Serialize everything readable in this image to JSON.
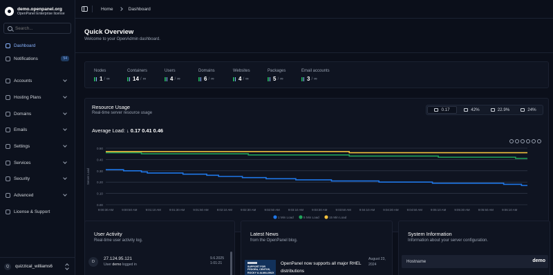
{
  "brand": {
    "title": "demo.openpanel.org",
    "subtitle": "OpenPanel Enterprise license"
  },
  "search": {
    "placeholder": "Search..."
  },
  "sidebar": {
    "items": [
      {
        "label": "Dashboard"
      },
      {
        "label": "Notifications",
        "badge": "54"
      },
      {
        "label": "Accounts"
      },
      {
        "label": "Hosting Plans"
      },
      {
        "label": "Domains"
      },
      {
        "label": "Emails"
      },
      {
        "label": "Settings"
      },
      {
        "label": "Services"
      },
      {
        "label": "Security"
      },
      {
        "label": "Advanced"
      },
      {
        "label": "License & Support"
      }
    ],
    "user": {
      "initial": "Q",
      "name": "quizzical_williams6"
    }
  },
  "breadcrumb": {
    "home": "Home",
    "current": "Dashboard"
  },
  "page": {
    "title": "Quick Overview",
    "subtitle": "Welcome to your OpenAdmin dashboard."
  },
  "stats": [
    {
      "label": "Nodes",
      "value": "1",
      "limit": "∞"
    },
    {
      "label": "Containers",
      "value": "14",
      "limit": "∞"
    },
    {
      "label": "Users",
      "value": "4",
      "limit": "∞"
    },
    {
      "label": "Domains",
      "value": "6",
      "limit": "∞"
    },
    {
      "label": "Websites",
      "value": "4",
      "limit": "∞"
    },
    {
      "label": "Packages",
      "value": "5",
      "limit": "∞"
    },
    {
      "label": "Email accounts",
      "value": "3",
      "limit": "∞"
    }
  ],
  "resource": {
    "title": "Resource Usage",
    "subtitle": "Real-time server resource usage",
    "tabs": [
      "0.17",
      "42%",
      "22.9%",
      "24%"
    ],
    "avg_label": "Average Load:",
    "avg_values": "0.17 0.41 0.46"
  },
  "colors": {
    "accent": "#8ab4ff",
    "load1": "#1f77e8",
    "load5": "#21a35a",
    "load15": "#f4c13d",
    "bg": "#0b0f1a"
  },
  "chart_data": {
    "type": "line",
    "x": [
      "9:00:30 AM",
      "9:00:35 AM",
      "9:00:40 AM",
      "9:00:45 AM",
      "9:00:50 AM",
      "9:00:55 AM",
      "9:01:00 AM",
      "9:01:05 AM",
      "9:01:10 AM",
      "9:01:15 AM",
      "9:01:20 AM",
      "9:01:25 AM",
      "9:01:30 AM",
      "9:01:35 AM",
      "9:01:40 AM",
      "9:01:45 AM",
      "9:01:50 AM",
      "9:01:55 AM",
      "9:02:00 AM",
      "9:02:05 AM",
      "9:02:10 AM",
      "9:02:15 AM",
      "9:02:20 AM",
      "9:02:25 AM",
      "9:02:30 AM",
      "9:02:35 AM",
      "9:02:40 AM",
      "9:02:45 AM",
      "9:02:50 AM",
      "9:02:55 AM",
      "9:03:00 AM",
      "9:03:05 AM",
      "9:03:10 AM",
      "9:03:15 AM",
      "9:03:20 AM",
      "9:03:25 AM",
      "9:03:30 AM",
      "9:03:35 AM",
      "9:03:40 AM",
      "9:03:45 AM",
      "9:03:50 AM",
      "9:03:55 AM",
      "9:04:00 AM",
      "9:04:05 AM",
      "9:04:10 AM",
      "9:04:15 AM",
      "9:04:20 AM",
      "9:04:25 AM",
      "9:04:30 AM",
      "9:04:35 AM",
      "9:04:40 AM",
      "9:04:45 AM",
      "9:04:50 AM",
      "9:04:55 AM",
      "9:05:00 AM",
      "9:05:05 AM",
      "9:05:10 AM",
      "9:05:15 AM",
      "9:05:20 AM",
      "9:05:25 AM",
      "9:05:30 AM",
      "9:05:35 AM",
      "9:05:40 AM",
      "9:05:45 AM",
      "9:05:50 AM",
      "9:05:55 AM",
      "9:06:00 AM",
      "9:06:05 AM",
      "9:06:10 AM",
      "9:06:15 AM",
      "9:06:20 AM",
      "9:06:25 AM"
    ],
    "x_ticks": [
      "9:00:30 AM",
      "9:00:50 AM",
      "9:01:10 AM",
      "9:01:30 AM",
      "9:01:50 AM",
      "9:02:10 AM",
      "9:02:30 AM",
      "9:02:50 AM",
      "9:03:10 AM",
      "9:03:30 AM",
      "9:03:50 AM",
      "9:04:10 AM",
      "9:04:30 AM",
      "9:04:50 AM",
      "9:05:10 AM",
      "9:05:30 AM",
      "9:05:50 AM",
      "9:06:10 AM"
    ],
    "y_ticks": [
      "0.50",
      "0.40",
      "0.30",
      "0.20",
      "0.10",
      "0.00"
    ],
    "ylim": [
      0,
      0.5
    ],
    "ylabel": "Server Load",
    "series": [
      {
        "name": "1 Min Load",
        "color": "#1f77e8",
        "values": [
          0.31,
          0.31,
          0.31,
          0.3,
          0.3,
          0.3,
          0.29,
          0.28,
          0.28,
          0.28,
          0.28,
          0.28,
          0.28,
          0.27,
          0.27,
          0.27,
          0.27,
          0.26,
          0.26,
          0.25,
          0.25,
          0.25,
          0.25,
          0.24,
          0.24,
          0.24,
          0.24,
          0.23,
          0.23,
          0.23,
          0.23,
          0.23,
          0.22,
          0.22,
          0.22,
          0.22,
          0.22,
          0.22,
          0.21,
          0.21,
          0.21,
          0.21,
          0.21,
          0.21,
          0.21,
          0.21,
          0.2,
          0.2,
          0.2,
          0.2,
          0.2,
          0.2,
          0.2,
          0.2,
          0.2,
          0.19,
          0.19,
          0.19,
          0.19,
          0.19,
          0.19,
          0.19,
          0.19,
          0.19,
          0.19,
          0.19,
          0.19,
          0.18,
          0.18,
          0.18,
          0.17,
          0.17
        ]
      },
      {
        "name": "5 Min Load",
        "color": "#21a35a",
        "values": [
          0.46,
          0.46,
          0.46,
          0.46,
          0.46,
          0.46,
          0.45,
          0.45,
          0.45,
          0.45,
          0.45,
          0.45,
          0.45,
          0.45,
          0.45,
          0.45,
          0.45,
          0.45,
          0.45,
          0.45,
          0.45,
          0.45,
          0.45,
          0.45,
          0.44,
          0.44,
          0.44,
          0.44,
          0.44,
          0.44,
          0.44,
          0.44,
          0.44,
          0.44,
          0.44,
          0.44,
          0.44,
          0.44,
          0.44,
          0.44,
          0.44,
          0.43,
          0.43,
          0.43,
          0.43,
          0.43,
          0.43,
          0.43,
          0.43,
          0.43,
          0.43,
          0.43,
          0.43,
          0.43,
          0.43,
          0.43,
          0.42,
          0.42,
          0.42,
          0.42,
          0.42,
          0.42,
          0.42,
          0.42,
          0.42,
          0.42,
          0.42,
          0.42,
          0.42,
          0.41,
          0.41,
          0.41
        ]
      },
      {
        "name": "15 Min Load",
        "color": "#f4c13d",
        "values": [
          0.47,
          0.47,
          0.47,
          0.47,
          0.47,
          0.47,
          0.47,
          0.47,
          0.47,
          0.47,
          0.47,
          0.47,
          0.47,
          0.47,
          0.47,
          0.47,
          0.47,
          0.47,
          0.47,
          0.47,
          0.47,
          0.47,
          0.47,
          0.47,
          0.47,
          0.47,
          0.47,
          0.47,
          0.47,
          0.47,
          0.47,
          0.47,
          0.47,
          0.47,
          0.47,
          0.47,
          0.47,
          0.47,
          0.47,
          0.47,
          0.47,
          0.46,
          0.46,
          0.46,
          0.46,
          0.46,
          0.46,
          0.46,
          0.46,
          0.46,
          0.46,
          0.46,
          0.46,
          0.46,
          0.46,
          0.46,
          0.46,
          0.46,
          0.46,
          0.46,
          0.46,
          0.46,
          0.46,
          0.46,
          0.46,
          0.46,
          0.46,
          0.46,
          0.46,
          0.46,
          0.46,
          0.46
        ]
      }
    ]
  },
  "activity": {
    "title": "User Activity",
    "subtitle": "Real-time user activity log.",
    "item": {
      "initial": "D",
      "ip": "27.124.95.121",
      "prefix": "User",
      "user": "demo",
      "suffix": "logged in",
      "date": "9.6.2025",
      "time": "1:01:21"
    }
  },
  "news": {
    "title": "Latest News",
    "subtitle": "from the OpenPanel blog.",
    "item": {
      "headline": "OpenPanel now supports all major RHEL distributions",
      "date_line1": "August 23,",
      "date_line2": "2024",
      "thumb_text": "SUPPORT FOR FEDORA, CENTOS, ROCKY & ALMALINUX"
    }
  },
  "sysinfo": {
    "title": "System Information",
    "subtitle": "Information about your server configuration.",
    "rows": [
      {
        "key": "Hostname",
        "value": "demo"
      }
    ]
  }
}
